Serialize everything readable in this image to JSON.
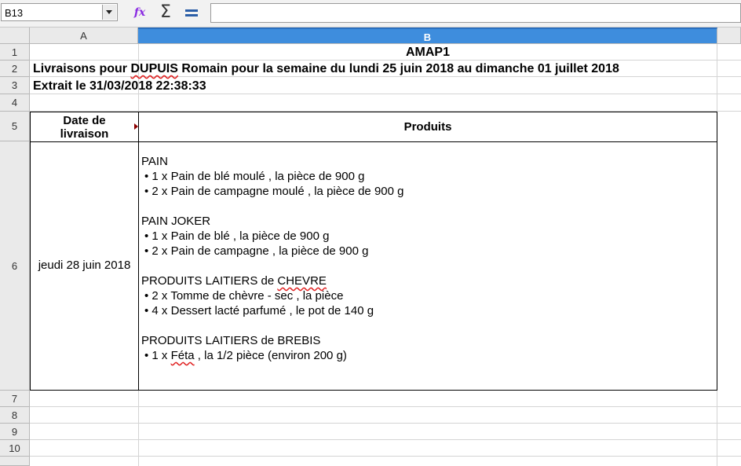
{
  "formula_bar": {
    "name_box": "B13",
    "formula": "",
    "icons": [
      "function-wizard-icon",
      "sum-icon",
      "equals-icon"
    ],
    "wizard_glyph": "fx",
    "sum_glyph": "Σ"
  },
  "columns": [
    "A",
    "B"
  ],
  "rows": [
    "1",
    "2",
    "3",
    "4",
    "5",
    "6",
    "7",
    "8",
    "9",
    "10"
  ],
  "sheet": {
    "b1": "AMAP1",
    "a2_prefix": "Livraisons pour ",
    "a2_name": "DUPUIS",
    "a2_suffix": " Romain pour la semaine du lundi 25 juin 2018 au dimanche 01 juillet 2018",
    "a3": "Extrait le 31/03/2018 22:38:33"
  },
  "table": {
    "header_date": "Date de livraison",
    "header_products": "Produits",
    "date": "jeudi 28 juin 2018",
    "groups": [
      {
        "title": "PAIN",
        "items": [
          {
            "bullet": "• 1 x ",
            "text": "Pain de blé moulé , la pièce de 900 g"
          },
          {
            "bullet": "• 2 x ",
            "text": "Pain de campagne moulé , la pièce de 900 g"
          }
        ]
      },
      {
        "title": "PAIN JOKER",
        "items": [
          {
            "bullet": "• 1 x ",
            "text": "Pain de blé , la pièce de 900 g"
          },
          {
            "bullet": "• 2 x ",
            "text": "Pain de campagne , la pièce de 900 g"
          }
        ]
      },
      {
        "title_prefix": "PRODUITS LAITIERS de ",
        "title_wavy": "CHEVRE",
        "items": [
          {
            "bullet": "• 2 x ",
            "text": "Tomme de chèvre - sec , la pièce"
          },
          {
            "bullet": "• 4 x ",
            "text": "Dessert lacté parfumé , le pot de 140 g"
          }
        ]
      },
      {
        "title": "PRODUITS LAITIERS de BREBIS",
        "items": [
          {
            "bullet": "• 1 x ",
            "text_wavy": "Féta",
            "text": " , la 1/2 pièce (environ 200 g)"
          }
        ]
      }
    ]
  },
  "colors": {
    "selected_column_header": "#3e8ddd",
    "spellcheck": "#e02020",
    "comment_marker": "#8b0000"
  }
}
